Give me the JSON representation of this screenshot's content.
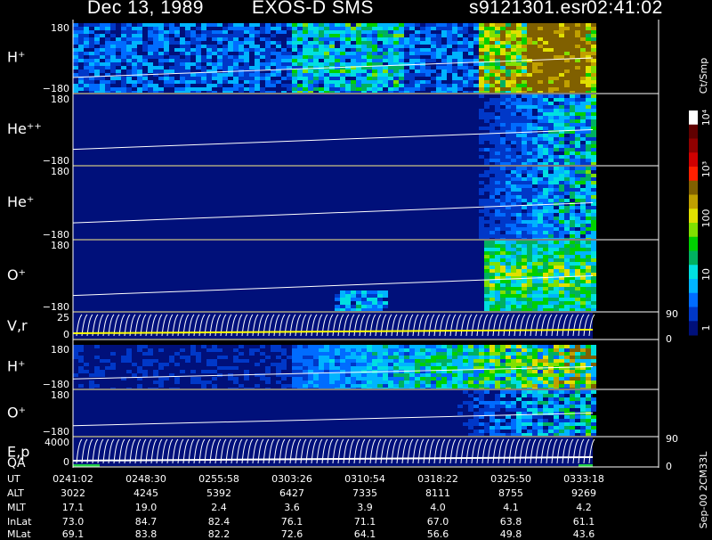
{
  "header": {
    "date": "Dec 13, 1989",
    "instrument": "EXOS-D SMS",
    "file": "s9121301.esr",
    "time": "02:41:02"
  },
  "side_labels": {
    "units": "Ct/Smp",
    "footer": "Sep-00 2CM33L"
  },
  "colorbar_ticks": [
    "10⁴",
    "10³",
    "100",
    "10",
    "1"
  ],
  "colors": {
    "background": "#000000",
    "panel_fill": "#00107a",
    "trace": "#ffffff",
    "vr_trace": "#ffff00",
    "qa_bar": "#22d045",
    "colorscale": [
      "#00107a",
      "#0038c8",
      "#006cff",
      "#00b4ff",
      "#00e0e0",
      "#00b060",
      "#00d000",
      "#80e000",
      "#e0e000",
      "#c0a000",
      "#806000",
      "#ff2000",
      "#d00000",
      "#900000",
      "#600000",
      "#ffffff"
    ]
  },
  "chart_data": {
    "type": "heatmap",
    "panels": [
      {
        "label": "H⁺",
        "yticks": [
          "180",
          "−180"
        ]
      },
      {
        "label": "He⁺⁺",
        "yticks": [
          "180",
          "−180"
        ]
      },
      {
        "label": "He⁺",
        "yticks": [
          "180",
          "−180"
        ]
      },
      {
        "label": "O⁺",
        "yticks": [
          "180",
          "−180"
        ]
      },
      {
        "label": "V,r",
        "yticks": [
          "25",
          "0"
        ],
        "right_ticks": [
          "90",
          "0"
        ]
      },
      {
        "label": "H⁺",
        "yticks": [
          "180",
          "−180"
        ]
      },
      {
        "label": "O⁺",
        "yticks": [
          "180",
          "−180"
        ]
      },
      {
        "label": "E,p",
        "sublabel": "QA",
        "yticks": [
          "4000",
          "0"
        ],
        "right_ticks": [
          "90",
          "0"
        ]
      }
    ],
    "ephemeris": {
      "row_labels": [
        "UT",
        "ALT",
        "MLT",
        "InLat",
        "MLat"
      ],
      "UT": [
        "0241:02",
        "0248:30",
        "0255:58",
        "0303:26",
        "0310:54",
        "0318:22",
        "0325:50",
        "0333:18"
      ],
      "ALT": [
        "3022",
        "4245",
        "5392",
        "6427",
        "7335",
        "8111",
        "8755",
        "9269"
      ],
      "MLT": [
        "17.1",
        "19.0",
        "2.4",
        "3.6",
        "3.9",
        "4.0",
        "4.1",
        "4.2"
      ],
      "InLat": [
        "73.0",
        "84.7",
        "82.4",
        "76.1",
        "71.1",
        "67.0",
        "63.8",
        "61.1"
      ],
      "MLat": [
        "69.1",
        "83.8",
        "82.2",
        "72.6",
        "64.1",
        "56.6",
        "49.8",
        "43.6"
      ]
    }
  }
}
